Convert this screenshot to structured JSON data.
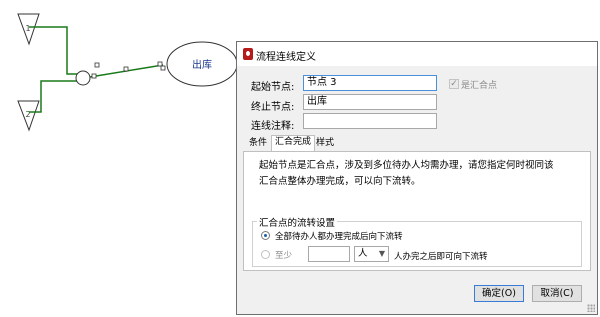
{
  "flow": {
    "node_label": "出库"
  },
  "dialog": {
    "title": "流程连线定义",
    "start_label": "起始节点:",
    "start_value": "节点 3",
    "end_label": "终止节点:",
    "end_value": "出库",
    "note_label": "连线注释:",
    "note_value": "",
    "merge_checkbox_label": "是汇合点",
    "merge_checked": true,
    "tabs": [
      {
        "label": "条件"
      },
      {
        "label": "汇合完成"
      },
      {
        "label": "样式"
      }
    ],
    "active_tab": 1,
    "description": "起始节点是汇合点，涉及到多位待办人均需办理，请您指定何时视同该汇合点整体办理完成，可以向下流转。",
    "group_title": "汇合点的流转设置",
    "option_all": "全部待办人都办理完成后向下流转",
    "option_least": "至少",
    "least_count": "",
    "least_unit": "人",
    "least_suffix": "人办完之后即可向下流转",
    "ok_label": "确定(O)",
    "cancel_label": "取消(C)"
  },
  "colors": {
    "connector": "#1a7a1a",
    "node_text": "#1a3a8a",
    "default_button_border": "#3a7bd5"
  }
}
